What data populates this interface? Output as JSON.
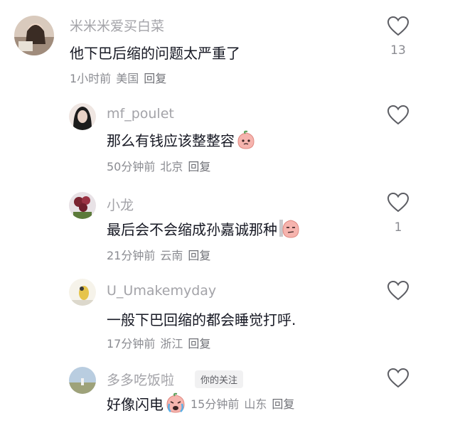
{
  "comments": [
    {
      "username": "米米米爱买白菜",
      "text": "他下巴后缩的问题太严重了",
      "time": "1小时前",
      "location": "美国",
      "reply_label": "回复",
      "like_count": "13",
      "avatar_colors": [
        "#c8b7a8",
        "#6d5a4c"
      ]
    },
    {
      "username": "mf_poulet",
      "text": "那么有钱应该整整容",
      "time": "50分钟前",
      "location": "北京",
      "reply_label": "回复",
      "like_count": "",
      "emoji": "peach-face-icon",
      "avatar_colors": [
        "#1c1c1c",
        "#efe6e2"
      ]
    },
    {
      "username": "小龙",
      "text": "最后会不会缩成孙嘉诚那种",
      "time": "21分钟前",
      "location": "云南",
      "reply_label": "回复",
      "like_count": "1",
      "emoji": "smirk-face-icon",
      "avatar_colors": [
        "#7a2430",
        "#5c7a3a"
      ]
    },
    {
      "username": "U_Umakemyday",
      "text": "一般下巴回缩的都会睡觉打呼.",
      "time": "17分钟前",
      "location": "浙江",
      "reply_label": "回复",
      "like_count": "",
      "avatar_colors": [
        "#f6f3ea",
        "#e6c44a"
      ]
    },
    {
      "username": "多多吃饭啦",
      "badge": "你的关注",
      "text": "好像闪电",
      "time": "15分钟前",
      "location": "山东",
      "reply_label": "回复",
      "like_count": "",
      "emoji": "crying-face-icon",
      "avatar_colors": [
        "#b9cde0",
        "#9ea27a"
      ]
    }
  ],
  "colors": {
    "username": "#a3a3a8",
    "text": "#161823",
    "meta": "#8a8b91",
    "heart_stroke": "#5c5d63"
  }
}
